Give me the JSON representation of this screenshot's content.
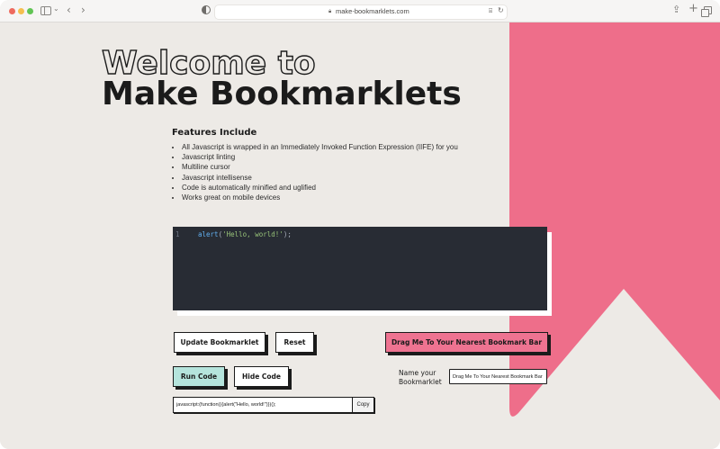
{
  "browser": {
    "url": "make-bookmarklets.com",
    "icons": [
      "sidebar-icon",
      "chevron-down-icon",
      "back-arrow-icon",
      "forward-arrow-icon",
      "shield-icon",
      "lock-icon",
      "translate-icon",
      "reload-icon",
      "share-icon",
      "new-tab-icon",
      "tab-overview-icon"
    ]
  },
  "hero": {
    "title_outline": "Welcome to",
    "title_solid": "Make Bookmarklets"
  },
  "features": {
    "heading": "Features Include",
    "items": [
      "All Javascript is wrapped in an Immediately Invoked Function Expression (IIFE) for you",
      "Javascript linting",
      "Multiline cursor",
      "Javascript intellisense",
      "Code is automatically minified and uglified",
      "Works great on mobile devices"
    ]
  },
  "editor": {
    "line_number": "1",
    "code_fn": "alert",
    "code_open": "(",
    "code_string": "'Hello, world!'",
    "code_close": ");"
  },
  "buttons": {
    "update": "Update Bookmarklet",
    "reset": "Reset",
    "drag": "Drag Me To Your Nearest Bookmark Bar",
    "run": "Run Code",
    "hide": "Hide Code",
    "copy": "Copy"
  },
  "bookmarklet_name": {
    "label": "Name your Bookmarklet",
    "value": "Drag Me To Your Nearest Bookmark Bar"
  },
  "output": {
    "value": "javascript:(function(){alert(\"Hello, world!\")})();"
  },
  "colors": {
    "background": "#edeae6",
    "ribbon": "#ee6e8a",
    "drag_button": "#ee7391",
    "run_button": "#b5e4dc",
    "editor_bg": "#282c34",
    "text": "#1b1b1b"
  }
}
